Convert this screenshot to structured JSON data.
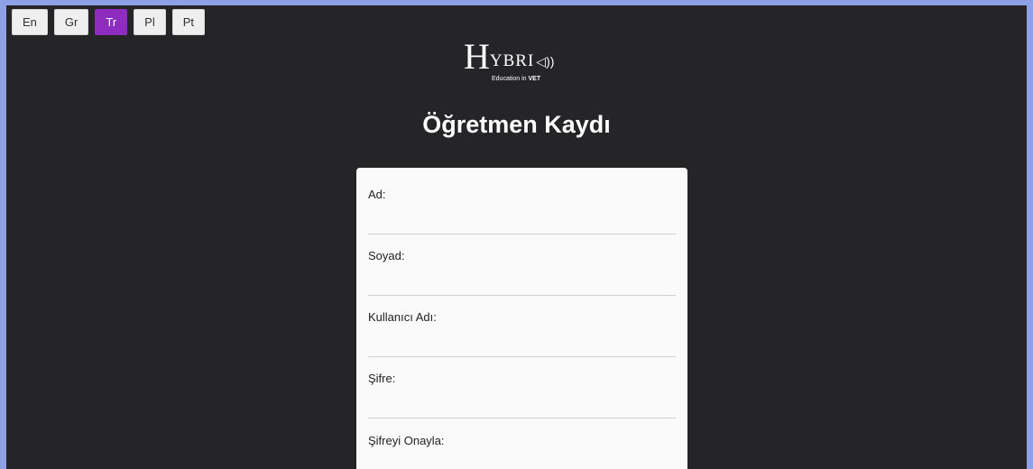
{
  "language_bar": {
    "buttons": [
      {
        "label": "En",
        "active": false
      },
      {
        "label": "Gr",
        "active": false
      },
      {
        "label": "Tr",
        "active": true
      },
      {
        "label": "Pl",
        "active": false
      },
      {
        "label": "Pt",
        "active": false
      }
    ],
    "active_color": "#8e2cc0"
  },
  "logo": {
    "main_letter": "H",
    "rest_text": "YBRI",
    "waves": "◁))",
    "subtitle_prefix": "Education in",
    "subtitle_bold": "VET"
  },
  "page_title": "Öğretmen Kaydı",
  "form": {
    "fields": [
      {
        "label": "Ad:",
        "value": ""
      },
      {
        "label": "Soyad:",
        "value": ""
      },
      {
        "label": "Kullanıcı Adı:",
        "value": ""
      },
      {
        "label": "Şifre:",
        "value": ""
      },
      {
        "label": "Şifreyi Onayla:",
        "value": ""
      }
    ]
  },
  "colors": {
    "background": "#252528",
    "border": "#8ea0e6",
    "card": "#fafafa"
  }
}
